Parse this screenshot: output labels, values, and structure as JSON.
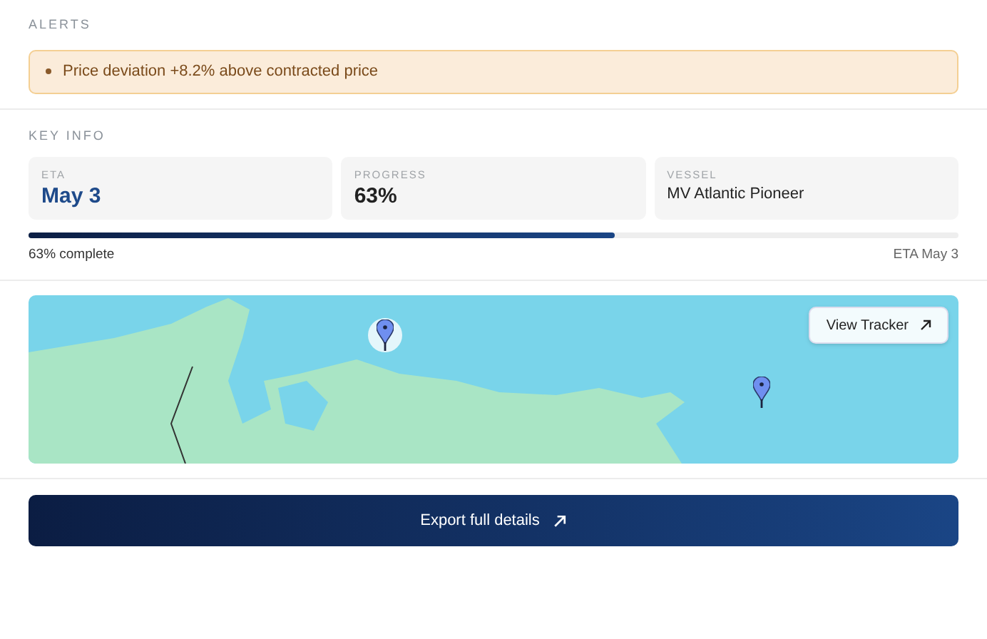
{
  "alerts": {
    "heading": "ALERTS",
    "items": [
      "Price deviation +8.2% above contracted price"
    ]
  },
  "key_info": {
    "heading": "KEY INFO",
    "cards": [
      {
        "label": "ETA",
        "value": "May 3",
        "kind": "highlight"
      },
      {
        "label": "PROGRESS",
        "value": "63%",
        "kind": "large"
      },
      {
        "label": "VESSEL",
        "value": "MV Atlantic Pioneer",
        "kind": "plain"
      }
    ],
    "progress": {
      "level": 0.63,
      "left_text": "63% complete",
      "right_text": "ETA May 3"
    }
  },
  "map": {
    "button": "View Tracker"
  },
  "export_button": "Export full details"
}
